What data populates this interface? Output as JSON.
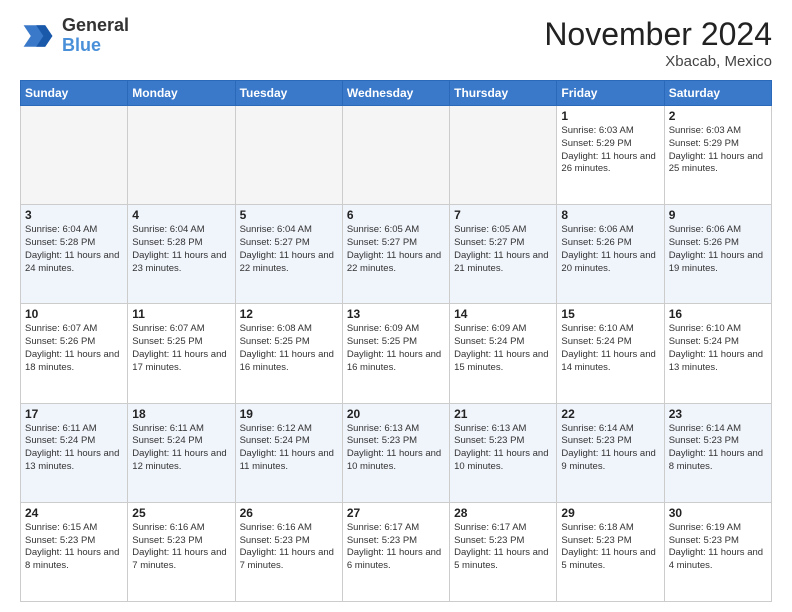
{
  "header": {
    "logo_general": "General",
    "logo_blue": "Blue",
    "month_title": "November 2024",
    "location": "Xbacab, Mexico"
  },
  "weekdays": [
    "Sunday",
    "Monday",
    "Tuesday",
    "Wednesday",
    "Thursday",
    "Friday",
    "Saturday"
  ],
  "weeks": [
    [
      {
        "day": "",
        "info": ""
      },
      {
        "day": "",
        "info": ""
      },
      {
        "day": "",
        "info": ""
      },
      {
        "day": "",
        "info": ""
      },
      {
        "day": "",
        "info": ""
      },
      {
        "day": "1",
        "info": "Sunrise: 6:03 AM\nSunset: 5:29 PM\nDaylight: 11 hours and 26 minutes."
      },
      {
        "day": "2",
        "info": "Sunrise: 6:03 AM\nSunset: 5:29 PM\nDaylight: 11 hours and 25 minutes."
      }
    ],
    [
      {
        "day": "3",
        "info": "Sunrise: 6:04 AM\nSunset: 5:28 PM\nDaylight: 11 hours and 24 minutes."
      },
      {
        "day": "4",
        "info": "Sunrise: 6:04 AM\nSunset: 5:28 PM\nDaylight: 11 hours and 23 minutes."
      },
      {
        "day": "5",
        "info": "Sunrise: 6:04 AM\nSunset: 5:27 PM\nDaylight: 11 hours and 22 minutes."
      },
      {
        "day": "6",
        "info": "Sunrise: 6:05 AM\nSunset: 5:27 PM\nDaylight: 11 hours and 22 minutes."
      },
      {
        "day": "7",
        "info": "Sunrise: 6:05 AM\nSunset: 5:27 PM\nDaylight: 11 hours and 21 minutes."
      },
      {
        "day": "8",
        "info": "Sunrise: 6:06 AM\nSunset: 5:26 PM\nDaylight: 11 hours and 20 minutes."
      },
      {
        "day": "9",
        "info": "Sunrise: 6:06 AM\nSunset: 5:26 PM\nDaylight: 11 hours and 19 minutes."
      }
    ],
    [
      {
        "day": "10",
        "info": "Sunrise: 6:07 AM\nSunset: 5:26 PM\nDaylight: 11 hours and 18 minutes."
      },
      {
        "day": "11",
        "info": "Sunrise: 6:07 AM\nSunset: 5:25 PM\nDaylight: 11 hours and 17 minutes."
      },
      {
        "day": "12",
        "info": "Sunrise: 6:08 AM\nSunset: 5:25 PM\nDaylight: 11 hours and 16 minutes."
      },
      {
        "day": "13",
        "info": "Sunrise: 6:09 AM\nSunset: 5:25 PM\nDaylight: 11 hours and 16 minutes."
      },
      {
        "day": "14",
        "info": "Sunrise: 6:09 AM\nSunset: 5:24 PM\nDaylight: 11 hours and 15 minutes."
      },
      {
        "day": "15",
        "info": "Sunrise: 6:10 AM\nSunset: 5:24 PM\nDaylight: 11 hours and 14 minutes."
      },
      {
        "day": "16",
        "info": "Sunrise: 6:10 AM\nSunset: 5:24 PM\nDaylight: 11 hours and 13 minutes."
      }
    ],
    [
      {
        "day": "17",
        "info": "Sunrise: 6:11 AM\nSunset: 5:24 PM\nDaylight: 11 hours and 13 minutes."
      },
      {
        "day": "18",
        "info": "Sunrise: 6:11 AM\nSunset: 5:24 PM\nDaylight: 11 hours and 12 minutes."
      },
      {
        "day": "19",
        "info": "Sunrise: 6:12 AM\nSunset: 5:24 PM\nDaylight: 11 hours and 11 minutes."
      },
      {
        "day": "20",
        "info": "Sunrise: 6:13 AM\nSunset: 5:23 PM\nDaylight: 11 hours and 10 minutes."
      },
      {
        "day": "21",
        "info": "Sunrise: 6:13 AM\nSunset: 5:23 PM\nDaylight: 11 hours and 10 minutes."
      },
      {
        "day": "22",
        "info": "Sunrise: 6:14 AM\nSunset: 5:23 PM\nDaylight: 11 hours and 9 minutes."
      },
      {
        "day": "23",
        "info": "Sunrise: 6:14 AM\nSunset: 5:23 PM\nDaylight: 11 hours and 8 minutes."
      }
    ],
    [
      {
        "day": "24",
        "info": "Sunrise: 6:15 AM\nSunset: 5:23 PM\nDaylight: 11 hours and 8 minutes."
      },
      {
        "day": "25",
        "info": "Sunrise: 6:16 AM\nSunset: 5:23 PM\nDaylight: 11 hours and 7 minutes."
      },
      {
        "day": "26",
        "info": "Sunrise: 6:16 AM\nSunset: 5:23 PM\nDaylight: 11 hours and 7 minutes."
      },
      {
        "day": "27",
        "info": "Sunrise: 6:17 AM\nSunset: 5:23 PM\nDaylight: 11 hours and 6 minutes."
      },
      {
        "day": "28",
        "info": "Sunrise: 6:17 AM\nSunset: 5:23 PM\nDaylight: 11 hours and 5 minutes."
      },
      {
        "day": "29",
        "info": "Sunrise: 6:18 AM\nSunset: 5:23 PM\nDaylight: 11 hours and 5 minutes."
      },
      {
        "day": "30",
        "info": "Sunrise: 6:19 AM\nSunset: 5:23 PM\nDaylight: 11 hours and 4 minutes."
      }
    ]
  ]
}
